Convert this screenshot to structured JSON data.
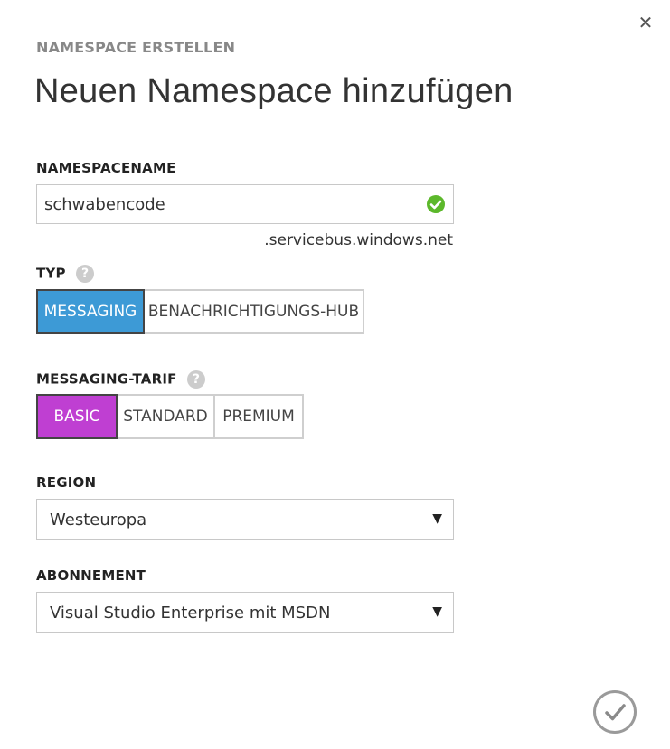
{
  "dialog": {
    "subtitle": "NAMESPACE ERSTELLEN",
    "title": "Neuen Namespace hinzufügen",
    "close_icon": "close-icon",
    "confirm_icon": "checkmark-icon"
  },
  "namespace": {
    "label": "NAMESPACENAME",
    "value": "schwabencode",
    "status_icon": "valid-check-icon",
    "suffix": ".servicebus.windows.net"
  },
  "typ": {
    "label": "TYP",
    "help": "?",
    "options": [
      "MESSAGING",
      "BENACHRICHTIGUNGS-HUB"
    ],
    "selected": "MESSAGING"
  },
  "tarif": {
    "label": "MESSAGING-TARIF",
    "help": "?",
    "options": [
      "BASIC",
      "STANDARD",
      "PREMIUM"
    ],
    "selected": "BASIC"
  },
  "region": {
    "label": "REGION",
    "value": "Westeuropa"
  },
  "abonnement": {
    "label": "ABONNEMENT",
    "value": "Visual Studio Enterprise mit MSDN"
  },
  "colors": {
    "typ_selected": "#3d9ad6",
    "tarif_selected": "#bf3fd2",
    "valid": "#5cb82b"
  }
}
